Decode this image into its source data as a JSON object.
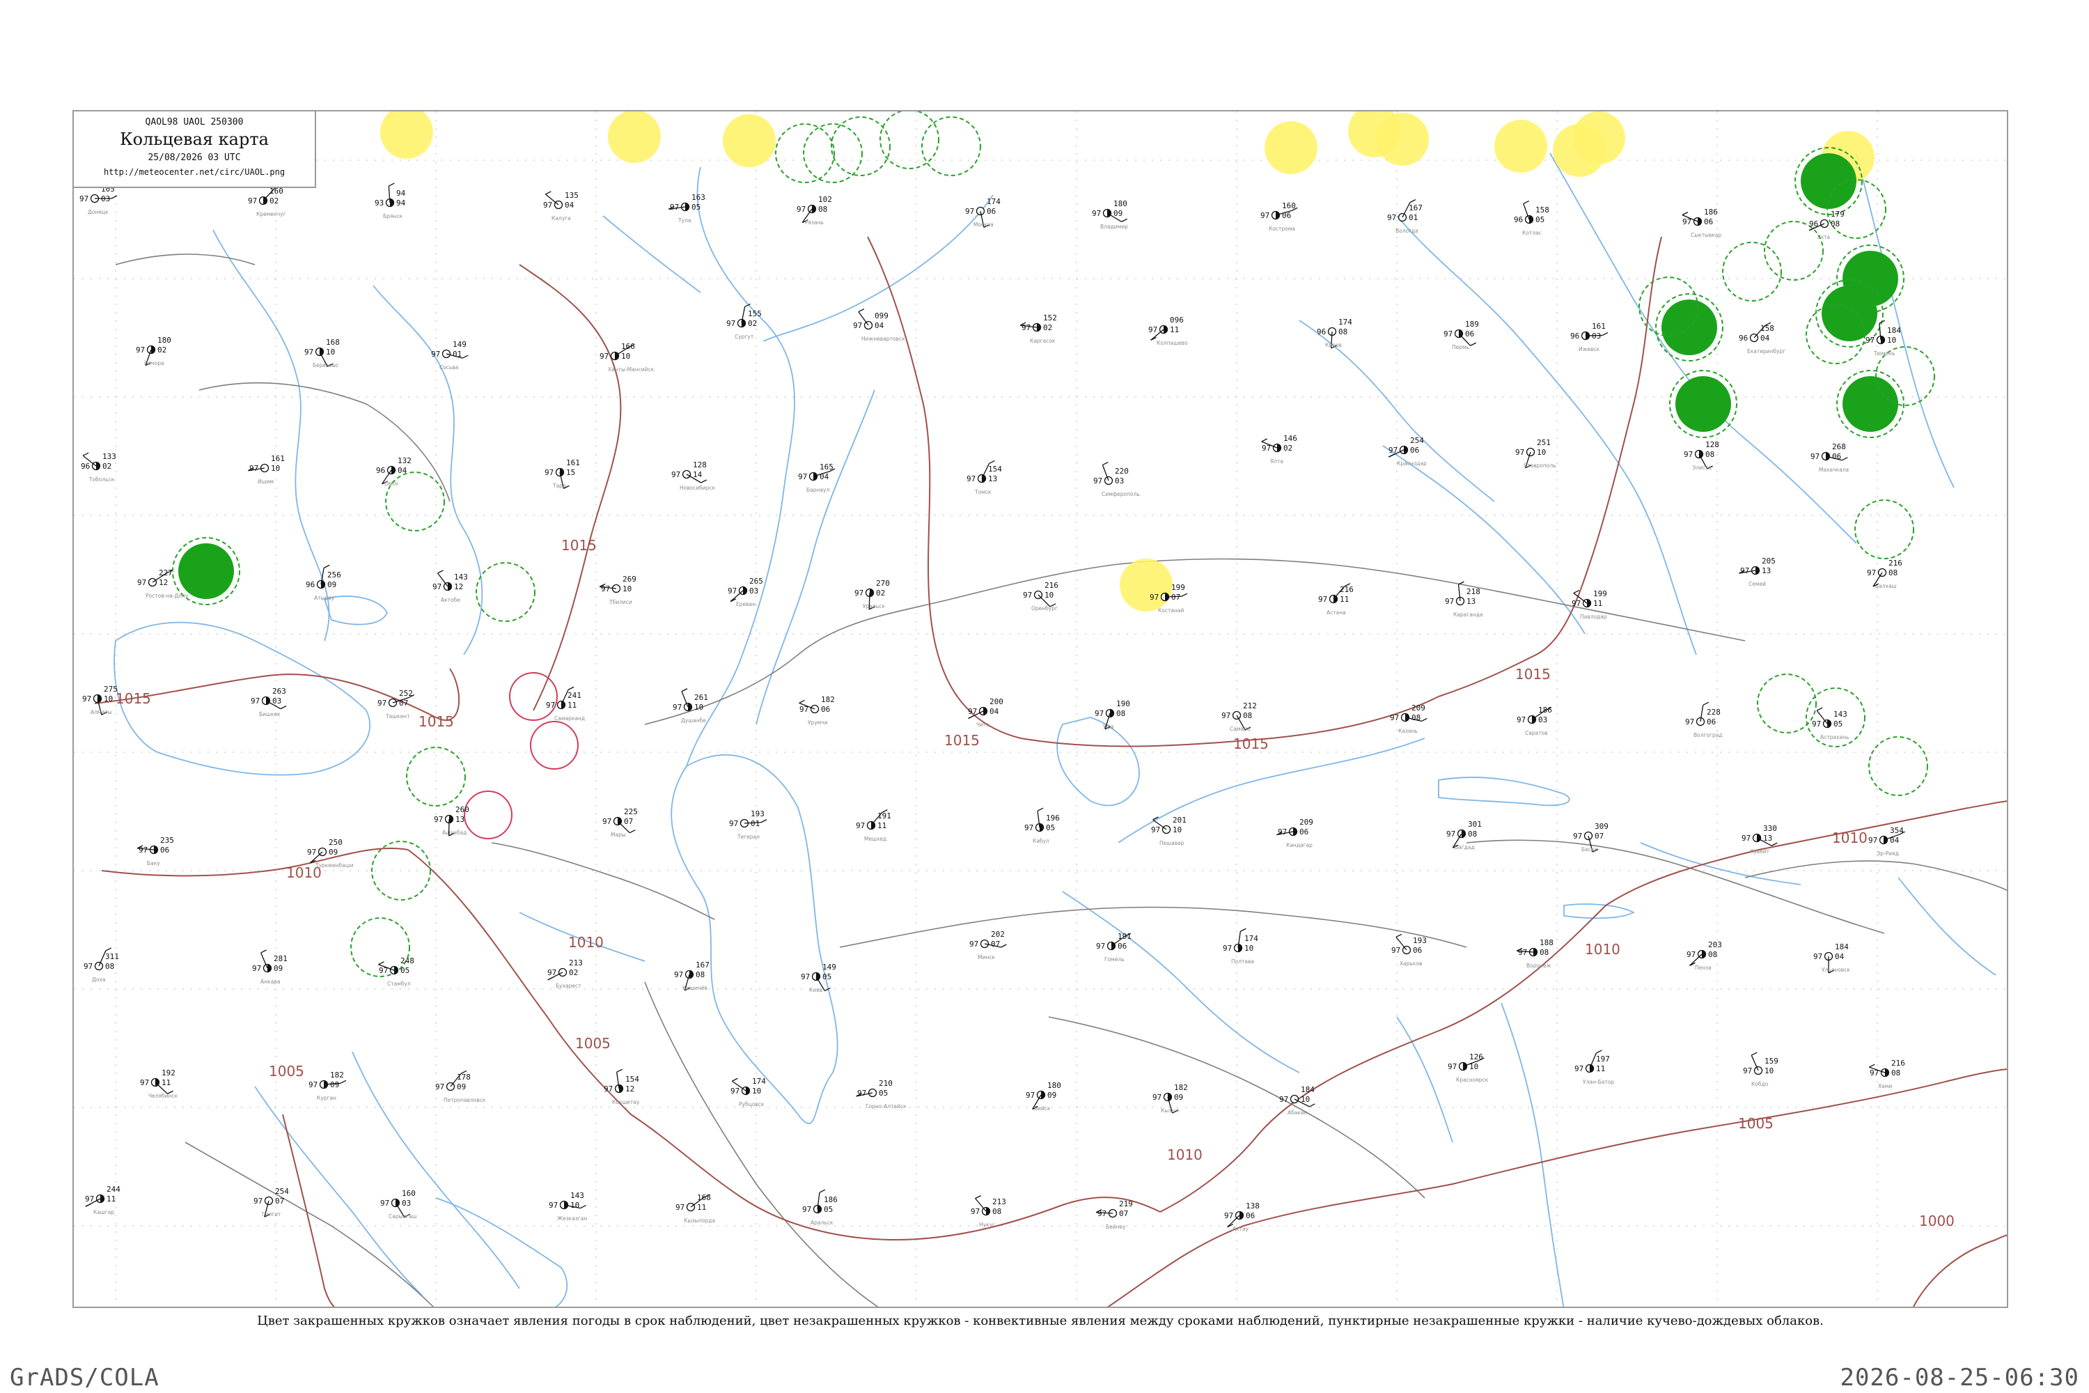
{
  "header": {
    "codes": "QAOL98  UAOL  250300",
    "title": "Кольцевая карта",
    "datetime": "25/08/2026 03 UTC",
    "url": "http://meteocenter.net/circ/UAOL.png"
  },
  "caption": "Цвет закрашенных кружков означает явления погоды в срок наблюдений, цвет незакрашенных кружков - конвективные явления между сроками наблюдений, пунктирные незакрашенные кружки - наличие кучево-дождевых облаков.",
  "footer": {
    "left": "GrADS/COLA",
    "right": "2026-08-25-06:30"
  },
  "colors": {
    "isobar": "#a0504a",
    "river": "#7fb6e6",
    "border": "#777777",
    "fog_fill": "#fff36b",
    "rain_fill": "#1aa31a",
    "thunder_ring": "#2aa02a",
    "hail_ring": "#d23c5a"
  },
  "isobars": [
    {
      "label": "1015"
    },
    {
      "label": "1015"
    },
    {
      "label": "1015"
    },
    {
      "label": "1015"
    },
    {
      "label": "1015"
    },
    {
      "label": "1015"
    },
    {
      "label": "1010"
    },
    {
      "label": "1010"
    },
    {
      "label": "1010"
    },
    {
      "label": "1010"
    },
    {
      "label": "1010"
    },
    {
      "label": "1005"
    },
    {
      "label": "1005"
    },
    {
      "label": "1005"
    },
    {
      "label": "1000"
    }
  ],
  "stations": [
    {
      "p": "105",
      "t": "97",
      "d": "03",
      "name": "Донецк"
    },
    {
      "p": "160",
      "t": "97",
      "d": "02",
      "name": "Кременчуг"
    },
    {
      "p": "94",
      "t": "93",
      "d": "94",
      "name": "Брянск"
    },
    {
      "p": "135",
      "t": "97",
      "d": "04",
      "name": "Калуга"
    },
    {
      "p": "163",
      "t": "97",
      "d": "05",
      "name": "Тула"
    },
    {
      "p": "102",
      "t": "97",
      "d": "08",
      "name": "Рязань"
    },
    {
      "p": "174",
      "t": "97",
      "d": "06",
      "name": "Москва"
    },
    {
      "p": "180",
      "t": "97",
      "d": "09",
      "name": "Владимир"
    },
    {
      "p": "160",
      "t": "97",
      "d": "06",
      "name": "Кострома"
    },
    {
      "p": "167",
      "t": "97",
      "d": "01",
      "name": "Вологда"
    },
    {
      "p": "158",
      "t": "96",
      "d": "05",
      "name": "Котлас"
    },
    {
      "p": "186",
      "t": "97",
      "d": "06",
      "name": "Сыктывкар"
    },
    {
      "p": "179",
      "t": "96",
      "d": "08",
      "name": "Ухта"
    },
    {
      "p": "180",
      "t": "97",
      "d": "02",
      "name": "Печора"
    },
    {
      "p": "168",
      "t": "97",
      "d": "10",
      "name": "Берёзово"
    },
    {
      "p": "149",
      "t": "97",
      "d": "01",
      "name": "Сосьва"
    },
    {
      "p": "166",
      "t": "97",
      "d": "10",
      "name": "Ханты-Мансийск"
    },
    {
      "p": "155",
      "t": "97",
      "d": "02",
      "name": "Сургут"
    },
    {
      "p": "099",
      "t": "97",
      "d": "04",
      "name": "Нижневартовск"
    },
    {
      "p": "152",
      "t": "97",
      "d": "02",
      "name": "Каргасок"
    },
    {
      "p": "096",
      "t": "97",
      "d": "11",
      "name": "Колпашево"
    },
    {
      "p": "174",
      "t": "96",
      "d": "08",
      "name": "Киров"
    },
    {
      "p": "189",
      "t": "97",
      "d": "06",
      "name": "Пермь"
    },
    {
      "p": "161",
      "t": "96",
      "d": "03",
      "name": "Ижевск"
    },
    {
      "p": "158",
      "t": "96",
      "d": "04",
      "name": "Екатеринбург"
    },
    {
      "p": "184",
      "t": "97",
      "d": "10",
      "name": "Тюмень"
    },
    {
      "p": "133",
      "t": "96",
      "d": "02",
      "name": "Тобольск"
    },
    {
      "p": "161",
      "t": "97",
      "d": "10",
      "name": "Ишим"
    },
    {
      "p": "132",
      "t": "96",
      "d": "04",
      "name": "Омск"
    },
    {
      "p": "161",
      "t": "97",
      "d": "15",
      "name": "Тара"
    },
    {
      "p": "128",
      "t": "97",
      "d": "14",
      "name": "Новосибирск"
    },
    {
      "p": "165",
      "t": "97",
      "d": "04",
      "name": "Барнаул"
    },
    {
      "p": "154",
      "t": "97",
      "d": "13",
      "name": "Томск"
    },
    {
      "p": "220",
      "t": "97",
      "d": "03",
      "name": "Симферополь"
    },
    {
      "p": "146",
      "t": "97",
      "d": "02",
      "name": "Ялта"
    },
    {
      "p": "254",
      "t": "97",
      "d": "06",
      "name": "Краснодар"
    },
    {
      "p": "251",
      "t": "97",
      "d": "10",
      "name": "Ставрополь"
    },
    {
      "p": "128",
      "t": "97",
      "d": "08",
      "name": "Элиста"
    },
    {
      "p": "268",
      "t": "97",
      "d": "06",
      "name": "Махачкала"
    },
    {
      "p": "227",
      "t": "97",
      "d": "12",
      "name": "Ростов-на-Дону"
    },
    {
      "p": "256",
      "t": "96",
      "d": "09",
      "name": "Атырау"
    },
    {
      "p": "143",
      "t": "97",
      "d": "12",
      "name": "Актобе"
    },
    {
      "p": "269",
      "t": "97",
      "d": "10",
      "name": "Тбилиси"
    },
    {
      "p": "265",
      "t": "97",
      "d": "03",
      "name": "Ереван"
    },
    {
      "p": "270",
      "t": "97",
      "d": "02",
      "name": "Уральск"
    },
    {
      "p": "216",
      "t": "97",
      "d": "10",
      "name": "Оренбург"
    },
    {
      "p": "199",
      "t": "97",
      "d": "07",
      "name": "Костанай"
    },
    {
      "p": "216",
      "t": "97",
      "d": "11",
      "name": "Астана"
    },
    {
      "p": "218",
      "t": "97",
      "d": "13",
      "name": "Караганда"
    },
    {
      "p": "199",
      "t": "97",
      "d": "11",
      "name": "Павлодар"
    },
    {
      "p": "205",
      "t": "97",
      "d": "13",
      "name": "Семей"
    },
    {
      "p": "216",
      "t": "97",
      "d": "08",
      "name": "Балхаш"
    },
    {
      "p": "275",
      "t": "97",
      "d": "10",
      "name": "Алматы"
    },
    {
      "p": "263",
      "t": "97",
      "d": "03",
      "name": "Бишкек"
    },
    {
      "p": "252",
      "t": "97",
      "d": "07",
      "name": "Ташкент"
    },
    {
      "p": "241",
      "t": "97",
      "d": "11",
      "name": "Самарканд"
    },
    {
      "p": "261",
      "t": "97",
      "d": "10",
      "name": "Душанбе"
    },
    {
      "p": "182",
      "t": "97",
      "d": "06",
      "name": "Урумчи"
    },
    {
      "p": "200",
      "t": "97",
      "d": "04",
      "name": "Чита"
    },
    {
      "p": "190",
      "t": "97",
      "d": "08",
      "name": "Уфа"
    },
    {
      "p": "212",
      "t": "97",
      "d": "08",
      "name": "Самара"
    },
    {
      "p": "209",
      "t": "97",
      "d": "08",
      "name": "Казань"
    },
    {
      "p": "186",
      "t": "97",
      "d": "03",
      "name": "Саратов"
    },
    {
      "p": "228",
      "t": "97",
      "d": "06",
      "name": "Волгоград"
    },
    {
      "p": "143",
      "t": "97",
      "d": "05",
      "name": "Астрахань"
    },
    {
      "p": "235",
      "t": "97",
      "d": "06",
      "name": "Баку"
    },
    {
      "p": "250",
      "t": "97",
      "d": "09",
      "name": "Туркменбаши"
    },
    {
      "p": "260",
      "t": "97",
      "d": "13",
      "name": "Ашхабад"
    },
    {
      "p": "225",
      "t": "97",
      "d": "07",
      "name": "Мары"
    },
    {
      "p": "193",
      "t": "97",
      "d": "01",
      "name": "Тегеран"
    },
    {
      "p": "191",
      "t": "97",
      "d": "11",
      "name": "Мешхед"
    },
    {
      "p": "196",
      "t": "97",
      "d": "05",
      "name": "Кабул"
    },
    {
      "p": "201",
      "t": "97",
      "d": "10",
      "name": "Пешавар"
    },
    {
      "p": "209",
      "t": "97",
      "d": "06",
      "name": "Кандагар"
    },
    {
      "p": "301",
      "t": "97",
      "d": "08",
      "name": "Багдад"
    },
    {
      "p": "309",
      "t": "97",
      "d": "07",
      "name": "Басра"
    },
    {
      "p": "330",
      "t": "97",
      "d": "13",
      "name": "Кувейт"
    },
    {
      "p": "354",
      "t": "97",
      "d": "04",
      "name": "Эр-Рияд"
    },
    {
      "p": "311",
      "t": "97",
      "d": "08",
      "name": "Доха"
    },
    {
      "p": "281",
      "t": "97",
      "d": "09",
      "name": "Анкара"
    },
    {
      "p": "248",
      "t": "97",
      "d": "05",
      "name": "Стамбул"
    },
    {
      "p": "213",
      "t": "97",
      "d": "02",
      "name": "Бухарест"
    },
    {
      "p": "167",
      "t": "97",
      "d": "08",
      "name": "Кишинёв"
    },
    {
      "p": "149",
      "t": "97",
      "d": "05",
      "name": "Киев"
    },
    {
      "p": "202",
      "t": "97",
      "d": "07",
      "name": "Минск"
    },
    {
      "p": "191",
      "t": "97",
      "d": "06",
      "name": "Гомель"
    },
    {
      "p": "174",
      "t": "97",
      "d": "10",
      "name": "Полтава"
    },
    {
      "p": "193",
      "t": "97",
      "d": "06",
      "name": "Харьков"
    },
    {
      "p": "188",
      "t": "97",
      "d": "08",
      "name": "Воронеж"
    },
    {
      "p": "203",
      "t": "97",
      "d": "08",
      "name": "Пенза"
    },
    {
      "p": "184",
      "t": "97",
      "d": "04",
      "name": "Ульяновск"
    },
    {
      "p": "192",
      "t": "97",
      "d": "11",
      "name": "Челябинск"
    },
    {
      "p": "182",
      "t": "97",
      "d": "09",
      "name": "Курган"
    },
    {
      "p": "178",
      "t": "97",
      "d": "09",
      "name": "Петропавловск"
    },
    {
      "p": "154",
      "t": "97",
      "d": "12",
      "name": "Кокшетау"
    },
    {
      "p": "174",
      "t": "97",
      "d": "10",
      "name": "Рубцовск"
    },
    {
      "p": "210",
      "t": "97",
      "d": "05",
      "name": "Горно-Алтайск"
    },
    {
      "p": "180",
      "t": "97",
      "d": "09",
      "name": "Бийск"
    },
    {
      "p": "182",
      "t": "97",
      "d": "09",
      "name": "Кызыл"
    },
    {
      "p": "184",
      "t": "97",
      "d": "10",
      "name": "Абакан"
    },
    {
      "p": "126",
      "t": "97",
      "d": "10",
      "name": "Красноярск"
    },
    {
      "p": "197",
      "t": "97",
      "d": "11",
      "name": "Улан-Батор"
    },
    {
      "p": "159",
      "t": "97",
      "d": "10",
      "name": "Кобдо"
    },
    {
      "p": "216",
      "t": "97",
      "d": "08",
      "name": "Хами"
    },
    {
      "p": "244",
      "t": "97",
      "d": "11",
      "name": "Кашгар"
    },
    {
      "p": "254",
      "t": "97",
      "d": "07",
      "name": "Гилгит"
    },
    {
      "p": "160",
      "t": "97",
      "d": "03",
      "name": "Сарыагаш"
    },
    {
      "p": "143",
      "t": "97",
      "d": "10",
      "name": "Жезказган"
    },
    {
      "p": "168",
      "t": "97",
      "d": "11",
      "name": "Кызылорда"
    },
    {
      "p": "186",
      "t": "97",
      "d": "05",
      "name": "Аральск"
    },
    {
      "p": "213",
      "t": "97",
      "d": "08",
      "name": "Нукус"
    },
    {
      "p": "219",
      "t": "97",
      "d": "07",
      "name": "Бейнеу"
    },
    {
      "p": "138",
      "t": "97",
      "d": "06",
      "name": "Актау"
    }
  ]
}
